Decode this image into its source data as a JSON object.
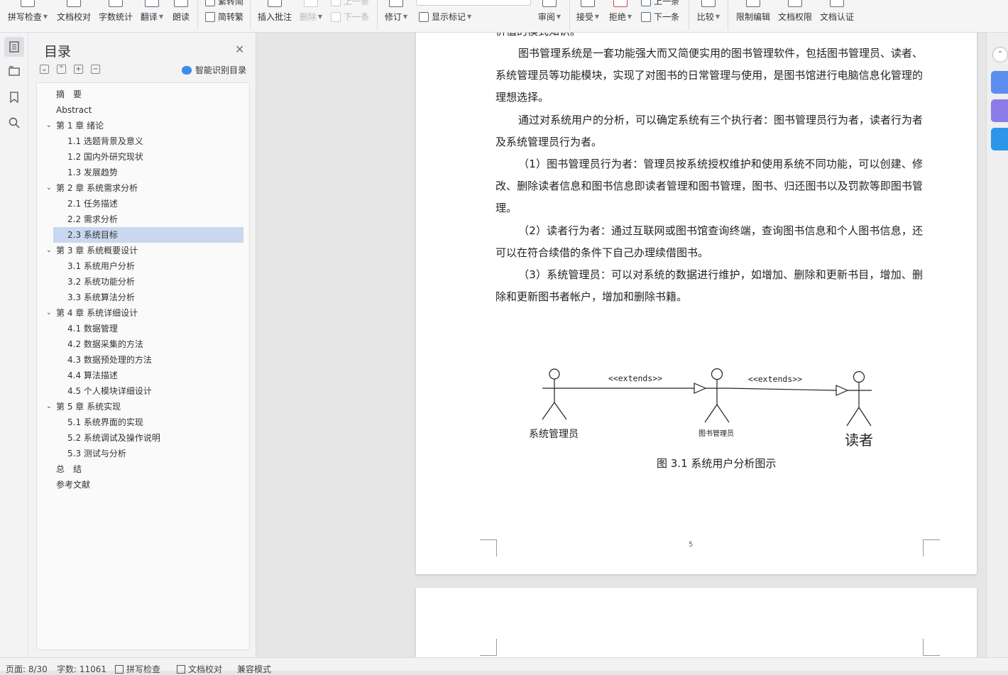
{
  "toolbar": {
    "spell_check": "拼写检查",
    "doc_proof": "文档校对",
    "word_count": "字数统计",
    "translate": "翻译",
    "read_aloud": "朗读",
    "trad_label_top": "繁转简",
    "simp_to_trad": "简转繁",
    "insert_comment": "插入批注",
    "delete": "删除",
    "prev": "上一条",
    "next": "下一条",
    "revise": "修订",
    "show_markup": "显示标记",
    "review": "审阅",
    "accept": "接受",
    "reject": "拒绝",
    "prev2": "上一条",
    "next2": "下一条",
    "compare": "比较",
    "restrict_edit": "限制编辑",
    "doc_rights": "文档权限",
    "doc_cert": "文档认证"
  },
  "toc": {
    "title": "目录",
    "smart_label": "智能识别目录",
    "items": [
      {
        "text": "摘　要",
        "level": 1
      },
      {
        "text": "Abstract",
        "level": 1
      },
      {
        "text": "第 1 章  绪论",
        "level": 1,
        "expand": true
      },
      {
        "text": "1.1 选题背景及意义",
        "level": 2
      },
      {
        "text": "1.2 国内外研究现状",
        "level": 2
      },
      {
        "text": "1.3 发展趋势",
        "level": 2
      },
      {
        "text": "第 2 章  系统需求分析",
        "level": 1,
        "expand": true
      },
      {
        "text": "2.1 任务描述",
        "level": 2
      },
      {
        "text": "2.2 需求分析",
        "level": 2
      },
      {
        "text": "2.3  系统目标",
        "level": 2,
        "selected": true
      },
      {
        "text": "第 3 章  系统概要设计",
        "level": 1,
        "expand": true
      },
      {
        "text": "3.1  系统用户分析",
        "level": 2
      },
      {
        "text": "3.2   系统功能分析",
        "level": 2
      },
      {
        "text": "3.3  系统算法分析",
        "level": 2
      },
      {
        "text": "第 4 章  系统详细设计",
        "level": 1,
        "expand": true
      },
      {
        "text": "4.1  数据管理",
        "level": 2
      },
      {
        "text": "4.2  数据采集的方法",
        "level": 2
      },
      {
        "text": "4.3  数据预处理的方法",
        "level": 2
      },
      {
        "text": "4.4  算法描述",
        "level": 2
      },
      {
        "text": "4.5  个人模块详细设计",
        "level": 2
      },
      {
        "text": "第 5 章  系统实现",
        "level": 1,
        "expand": true
      },
      {
        "text": "5.1  系统界面的实现",
        "level": 2
      },
      {
        "text": "5.2  系统调试及操作说明",
        "level": 2
      },
      {
        "text": "5.3  测试与分析",
        "level": 2
      },
      {
        "text": "总　结",
        "level": 1
      },
      {
        "text": "参考文献",
        "level": 1
      }
    ]
  },
  "document": {
    "top_partial": "价值的模式知识。",
    "p1": "图书管理系统是一套功能强大而又简便实用的图书管理软件，包括图书管理员、读者、系统管理员等功能模块，实现了对图书的日常管理与使用，是图书馆进行电脑信息化管理的理想选择。",
    "p2": "通过对系统用户的分析，可以确定系统有三个执行者：图书管理员行为者，读者行为者及系统管理员行为者。",
    "p3": "（1）图书管理员行为者：管理员按系统授权维护和使用系统不同功能，可以创建、修改、删除读者信息和图书信息即读者管理和图书管理，图书、归还图书以及罚款等即图书管理。",
    "p4": "（2）读者行为者：通过互联网或图书馆查询终端，查询图书信息和个人图书信息，还可以在符合续借的条件下自己办理续借图书。",
    "p5": "（3）系统管理员：可以对系统的数据进行维护，如增加、删除和更新书目，增加、删除和更新图书者帐户，增加和删除书籍。",
    "figure": {
      "actor1": "系统管理员",
      "actor2": "图书管理员",
      "actor3": "读者",
      "rel1": "<<extends>>",
      "rel2": "<<extends>>",
      "caption": "图  3.1  系统用户分析图示"
    },
    "page_number": "5"
  },
  "status": {
    "page": "页面: 8/30",
    "words": "字数: 11061",
    "spell": "拼写检查",
    "proof": "文档校对",
    "compat": "兼容模式"
  }
}
